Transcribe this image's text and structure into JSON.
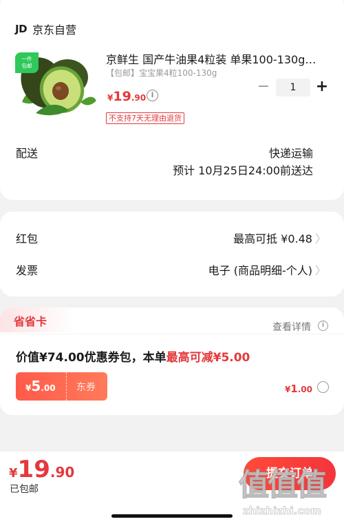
{
  "store": {
    "logo": "JD",
    "name": "京东自营"
  },
  "product": {
    "badge": "一件\n包邮",
    "title": "京鲜生 国产牛油果4粒装 单果100-130g…",
    "subtitle": "【包邮】宝宝果4粒100-130g",
    "price": {
      "symbol": "¥",
      "integer": "19",
      "decimal": ".90"
    },
    "info_icon": "i",
    "return_policy": "不支持7天无理由退货",
    "quantity": {
      "minus": "−",
      "value": "1",
      "plus": "+"
    }
  },
  "delivery": {
    "label": "配送",
    "method": "快递运输",
    "eta": "预计 10月25日24:00前送达"
  },
  "rows": [
    {
      "label": "红包",
      "value": "最高可抵 ¥0.48",
      "chevron": "〉"
    },
    {
      "label": "发票",
      "value": "电子 (商品明细-个人)",
      "chevron": "〉"
    }
  ],
  "savings_card": {
    "tag": "省省卡",
    "details_link": "查看详情",
    "details_icon": "i",
    "desc_prefix": "价值¥74.00优惠券包，本单",
    "desc_highlight": "最高可减¥5.00",
    "coupon": {
      "symbol": "¥",
      "integer": "5",
      "decimal": ".00",
      "type": "东券"
    },
    "price": {
      "symbol": "¥",
      "integer": "1",
      "decimal": ".00"
    }
  },
  "bottom": {
    "total": {
      "symbol": "¥",
      "integer": "19",
      "decimal": ".90"
    },
    "shipping_note": "已包邮",
    "submit_label": "提交订单"
  },
  "watermark": {
    "zh": "值值值",
    "en": "zhizhizhi.com"
  },
  "colors": {
    "accent": "#e4393c",
    "background": "#f2f2f2"
  }
}
